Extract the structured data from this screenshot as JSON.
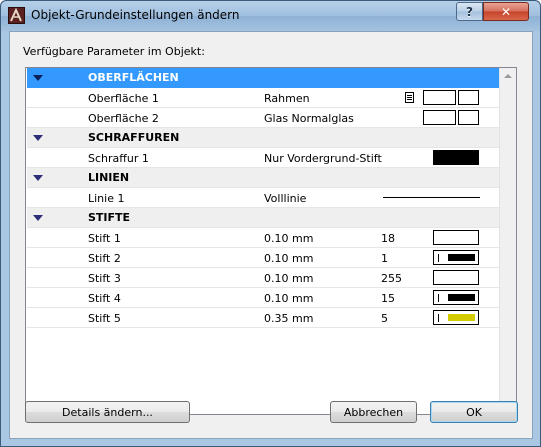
{
  "window": {
    "title": "Objekt-Grundeinstellungen ändern",
    "help_label": "?",
    "close_label": "✕"
  },
  "group_label": "Verfügbare Parameter im Objekt:",
  "list": {
    "groups": [
      {
        "name": "OBERFLÄCHEN",
        "selected": true,
        "items": [
          {
            "name": "Oberfläche 1",
            "value": "Rahmen",
            "control": "surface-swatch",
            "has_doc_icon": true
          },
          {
            "name": "Oberfläche 2",
            "value": "Glas Normalglas",
            "control": "surface-swatch",
            "has_doc_icon": false
          }
        ]
      },
      {
        "name": "SCHRAFFUREN",
        "selected": false,
        "items": [
          {
            "name": "Schraffur 1",
            "value": "Nur Vordergrund-Stift",
            "control": "fill-black"
          }
        ]
      },
      {
        "name": "LINIEN",
        "selected": false,
        "items": [
          {
            "name": "Linie 1",
            "value": "Volllinie",
            "control": "line-sample"
          }
        ]
      },
      {
        "name": "STIFTE",
        "selected": false,
        "items": [
          {
            "name": "Stift 1",
            "value": "0.10 mm",
            "number": "18",
            "control": "pen",
            "pen_color": ""
          },
          {
            "name": "Stift 2",
            "value": "0.10 mm",
            "number": "1",
            "control": "pen",
            "pen_color": "#000000"
          },
          {
            "name": "Stift 3",
            "value": "0.10 mm",
            "number": "255",
            "control": "pen",
            "pen_color": ""
          },
          {
            "name": "Stift 4",
            "value": "0.10 mm",
            "number": "15",
            "control": "pen",
            "pen_color": "#000000"
          },
          {
            "name": "Stift 5",
            "value": "0.35 mm",
            "number": "5",
            "control": "pen",
            "pen_color": "#d4cc00"
          }
        ]
      }
    ]
  },
  "buttons": {
    "details": "Details ändern...",
    "cancel": "Abbrechen",
    "ok": "OK"
  },
  "colors": {
    "selection": "#3399ff",
    "group_triangle": "#2b2f79"
  }
}
